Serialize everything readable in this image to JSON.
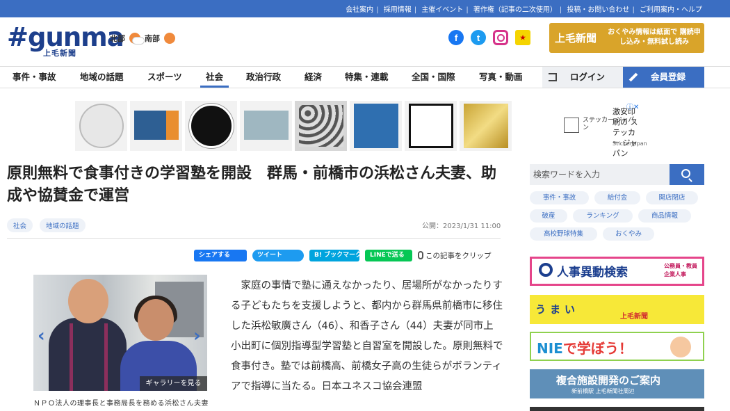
{
  "topbar": {
    "links": [
      "会社案内",
      "採用情報",
      "主催イベント",
      "著作権（記事の二次使用）",
      "投稿・お問い合わせ",
      "ご利用案内・ヘルプ"
    ]
  },
  "header": {
    "logo_main": "#gunma",
    "logo_sub": "上毛新聞",
    "weather": [
      {
        "region": "北部",
        "icon": "sun-cloud-icon"
      },
      {
        "region": "南部",
        "icon": "sun-icon"
      }
    ],
    "promo": {
      "title": "上毛新聞",
      "text": "おくやみ情報は紙面で 購読申し込み・無料試し読み"
    }
  },
  "nav": {
    "items": [
      "事件・事故",
      "地域の話題",
      "スポーツ",
      "社会",
      "政治行政",
      "経済",
      "特集・連載",
      "全国・国際",
      "写真・動画"
    ],
    "active": "社会",
    "login": "ログイン",
    "register": "会員登録"
  },
  "ad": {
    "title": "激安印刷の ステッカー ジャパン",
    "brand": "StickerJapan",
    "logo_text": "ステッカー ジャパン",
    "close": "ⓘ✕"
  },
  "article": {
    "headline": "原則無料で食事付きの学習塾を開設　群馬・前橋市の浜松さん夫妻、助成や協賛金で運営",
    "tags": [
      "社会",
      "地域の話題"
    ],
    "published": "公開：2023/1/31 11:00",
    "share": {
      "facebook": "シェアする",
      "twitter": "ツイート",
      "hatena": "B! ブックマーク",
      "line": "LINEで送る",
      "clip": "この記事をクリップ"
    },
    "gallery_button": "ギャラリーを見る",
    "caption": "ＮＰＯ法人の理事長と事務局長を務める浜松さん夫妻",
    "body": "家庭の事情で塾に通えなかったり、居場所がなかったりする子どもたちを支援しようと、都内から群馬県前橋市に移住した浜松敏廣さん（46）、和香子さん（44）夫妻が同市上小出町に個別指導型学習塾と自習室を開設した。原則無料で食事付き。塾では前橋高、前橋女子高の生徒らがボランティアで指導に当たる。日本ユネスコ協会連盟"
  },
  "sidebar": {
    "search_placeholder": "検索ワードを入力",
    "keywords": [
      "事件・事故",
      "給付金",
      "開店閉店",
      "破産",
      "ランキング",
      "商品情報",
      "高校野球特集",
      "おくやみ"
    ],
    "banners": {
      "jinji": {
        "title": "人事異動検索",
        "sub": "公務員・教員 企業人事"
      },
      "umai": {
        "title": "うまい",
        "sub": "上毛新聞"
      },
      "nie": {
        "prefix": "NIE",
        "rest": "で学ぼう！"
      },
      "fukugo": {
        "title": "複合施設開発のご案内",
        "sub": "新前橋駅 上毛新聞社周辺"
      }
    }
  }
}
